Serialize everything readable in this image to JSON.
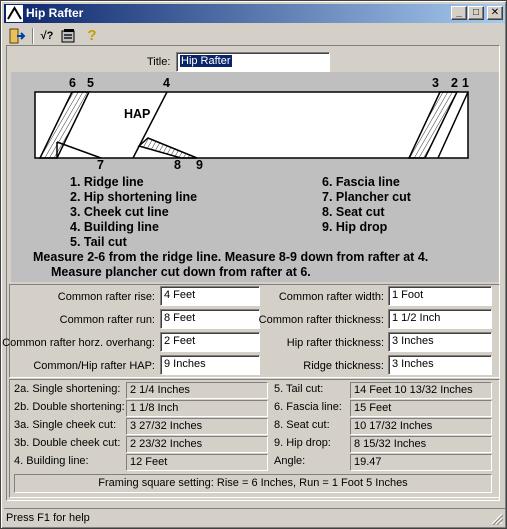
{
  "window": {
    "title": "Hip Rafter",
    "controls": {
      "minimize": "_",
      "maximize": "□",
      "close": "✕"
    }
  },
  "toolbar": {
    "items": [
      {
        "name": "exit-icon",
        "glyph": "⇥"
      },
      {
        "name": "calculate-icon",
        "glyph": "√?"
      },
      {
        "name": "settings-icon",
        "glyph": "▦"
      },
      {
        "name": "help-icon",
        "glyph": "?"
      }
    ]
  },
  "title_field": {
    "label": "Title:",
    "value": "Hip Rafter"
  },
  "diagram": {
    "top_numbers": {
      "n6": "6",
      "n5": "5",
      "n4": "4",
      "n3": "3",
      "n2": "2",
      "n1": "1"
    },
    "bottom_numbers": {
      "n7": "7",
      "n8": "8",
      "n9": "9"
    },
    "hap_label": "HAP"
  },
  "legend": {
    "left": [
      "1. Ridge line",
      "2. Hip shortening line",
      "3. Cheek cut line",
      "4. Building line",
      "5. Tail cut"
    ],
    "right": [
      "6. Fascia line",
      "7. Plancher cut",
      "8. Seat cut",
      "9. Hip drop"
    ]
  },
  "notes": {
    "line1": "Measure 2-6 from the ridge line.  Measure 8-9 down from rafter at 4.",
    "line2": "Measure plancher cut down from rafter at 6."
  },
  "inputs": {
    "common_rise": {
      "label": "Common rafter rise:",
      "value": "4 Feet"
    },
    "common_run": {
      "label": "Common rafter run:",
      "value": "8 Feet"
    },
    "common_overhang": {
      "label": "Common rafter horz. overhang:",
      "value": "2 Feet"
    },
    "hap": {
      "label": "Common/Hip rafter HAP:",
      "value": "9 Inches"
    },
    "common_width": {
      "label": "Common rafter width:",
      "value": "1 Foot"
    },
    "common_thickness": {
      "label": "Common rafter thickness:",
      "value": "1 1/2 Inch"
    },
    "hip_thickness": {
      "label": "Hip rafter thickness:",
      "value": "3 Inches"
    },
    "ridge_thickness": {
      "label": "Ridge thickness:",
      "value": "3 Inches"
    }
  },
  "results": {
    "single_shortening": {
      "label": "2a. Single shortening:",
      "value": "2 1/4 Inches"
    },
    "double_shortening": {
      "label": "2b. Double shortening:",
      "value": "1 1/8 Inch"
    },
    "single_cheek": {
      "label": "3a. Single cheek cut:",
      "value": "3 27/32 Inches"
    },
    "double_cheek": {
      "label": "3b. Double cheek cut:",
      "value": "2 23/32 Inches"
    },
    "building_line": {
      "label": "4. Building line:",
      "value": "12 Feet"
    },
    "tail_cut": {
      "label": "5.  Tail cut:",
      "value": "14 Feet 10 13/32 Inches"
    },
    "fascia_line": {
      "label": "6.  Fascia line:",
      "value": "15 Feet"
    },
    "seat_cut": {
      "label": "8.  Seat cut:",
      "value": "10 17/32 Inches"
    },
    "hip_drop": {
      "label": "9.  Hip drop:",
      "value": "8 15/32 Inches"
    },
    "angle": {
      "label": "Angle:",
      "value": "19.47"
    }
  },
  "framing_square": "Framing square setting: Rise = 6 Inches, Run = 1 Foot 5 Inches",
  "status": "Press F1 for help"
}
